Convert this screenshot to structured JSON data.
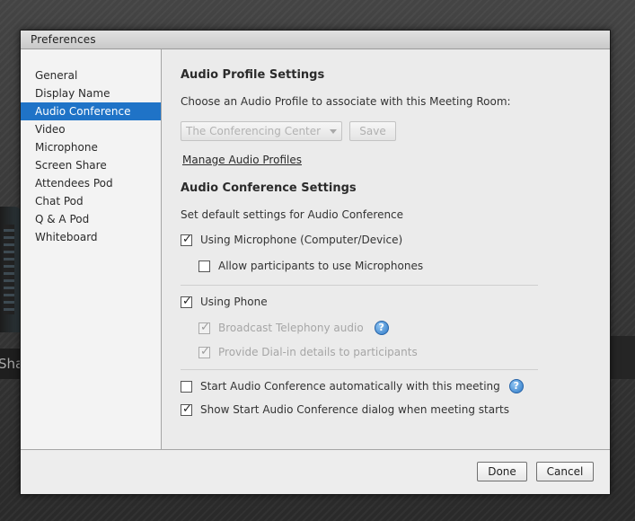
{
  "background": {
    "partial_text": "Sha"
  },
  "window": {
    "title": "Preferences"
  },
  "sidebar": {
    "items": [
      {
        "label": "General",
        "active": false
      },
      {
        "label": "Display Name",
        "active": false
      },
      {
        "label": "Audio Conference",
        "active": true
      },
      {
        "label": "Video",
        "active": false
      },
      {
        "label": "Microphone",
        "active": false
      },
      {
        "label": "Screen Share",
        "active": false
      },
      {
        "label": "Attendees Pod",
        "active": false
      },
      {
        "label": "Chat Pod",
        "active": false
      },
      {
        "label": "Q & A Pod",
        "active": false
      },
      {
        "label": "Whiteboard",
        "active": false
      }
    ]
  },
  "profile": {
    "heading": "Audio Profile Settings",
    "prompt": "Choose an Audio Profile to associate with this Meeting Room:",
    "select_value": "The Conferencing Center",
    "save_label": "Save",
    "manage_link": "Manage Audio Profiles"
  },
  "conference": {
    "heading": "Audio Conference Settings",
    "description": "Set default settings for Audio Conference",
    "options": {
      "using_microphone": {
        "label": "Using Microphone (Computer/Device)",
        "checked": true,
        "disabled": false
      },
      "allow_participants_mic": {
        "label": "Allow participants to use Microphones",
        "checked": false,
        "disabled": false
      },
      "using_phone": {
        "label": "Using Phone",
        "checked": true,
        "disabled": false
      },
      "broadcast_telephony": {
        "label": "Broadcast Telephony audio",
        "checked": true,
        "disabled": true
      },
      "provide_dialin": {
        "label": "Provide Dial-in details to participants",
        "checked": true,
        "disabled": true
      },
      "start_auto": {
        "label": "Start Audio Conference automatically with this meeting",
        "checked": false,
        "disabled": false
      },
      "show_start_dialog": {
        "label": "Show Start Audio Conference dialog when meeting starts",
        "checked": true,
        "disabled": false
      }
    },
    "help_glyph": "?",
    "check_glyph": "✓"
  },
  "footer": {
    "done_label": "Done",
    "cancel_label": "Cancel"
  },
  "colors": {
    "accent": "#1f73c7",
    "help": "#2e79c6"
  }
}
